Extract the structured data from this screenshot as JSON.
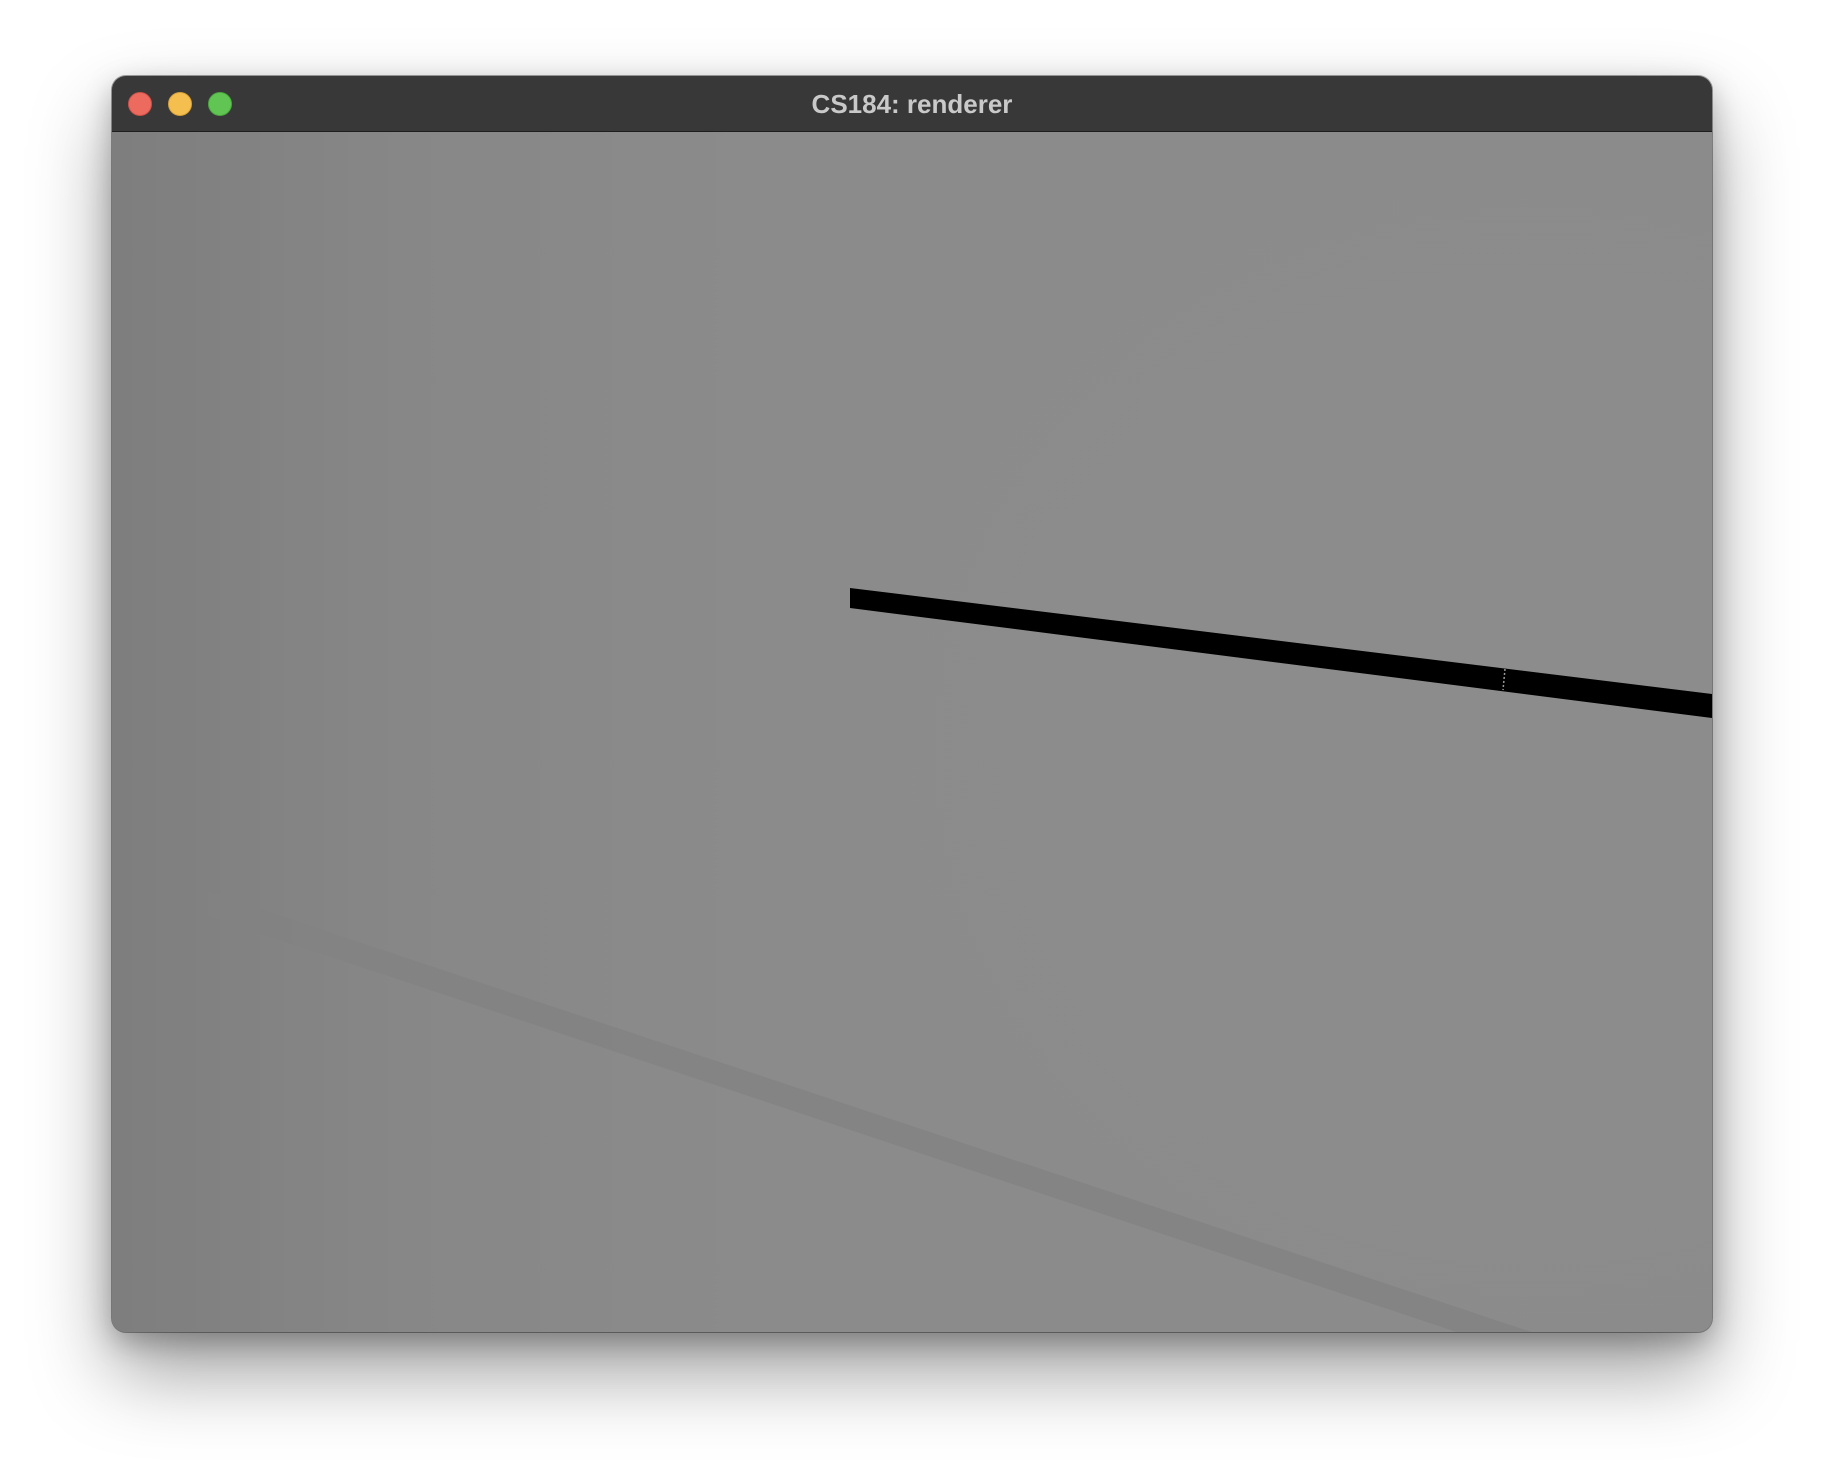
{
  "window": {
    "title": "CS184: renderer"
  },
  "colors": {
    "titlebar": "#383838",
    "title_text": "#c9c9c9",
    "viewport_background": "#8b8b8b",
    "close_button": "#ed6a5e",
    "minimize_button": "#f5bf4f",
    "zoom_button": "#61c554",
    "rendered_line": "#000000",
    "floor_line": "#848484"
  },
  "icons": {
    "close": "close-button-icon",
    "minimize": "minimize-button-icon",
    "zoom": "zoom-button-icon"
  }
}
